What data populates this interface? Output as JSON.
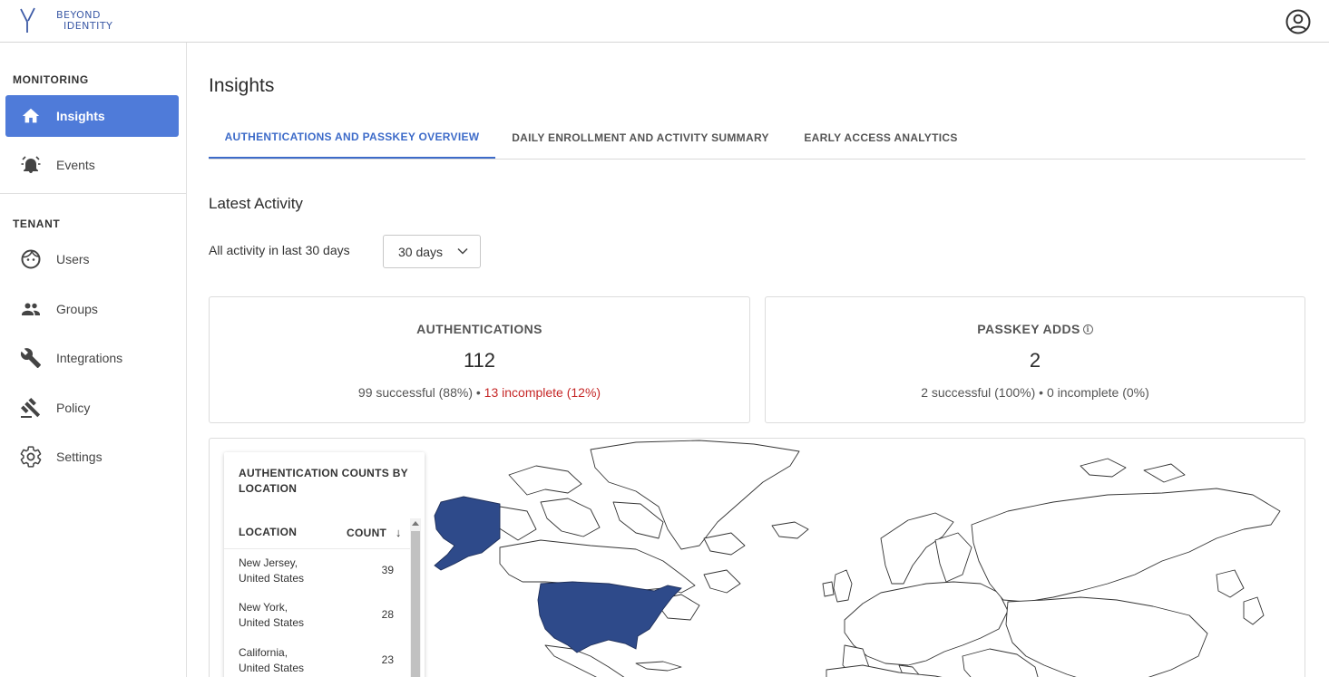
{
  "brand": {
    "line1": "BEYOND",
    "line2": "IDENTITY"
  },
  "sidebar": {
    "monitoring_label": "MONITORING",
    "tenant_label": "TENANT",
    "items": [
      {
        "label": "Insights",
        "icon": "home-icon"
      },
      {
        "label": "Events",
        "icon": "alarm-icon"
      },
      {
        "label": "Users",
        "icon": "face-icon"
      },
      {
        "label": "Groups",
        "icon": "people-icon"
      },
      {
        "label": "Integrations",
        "icon": "wrench-icon"
      },
      {
        "label": "Policy",
        "icon": "gavel-icon"
      },
      {
        "label": "Settings",
        "icon": "gear-icon"
      }
    ]
  },
  "page": {
    "title": "Insights"
  },
  "tabs": [
    "AUTHENTICATIONS AND PASSKEY OVERVIEW",
    "DAILY ENROLLMENT AND ACTIVITY SUMMARY",
    "EARLY ACCESS ANALYTICS"
  ],
  "activity": {
    "section_title": "Latest Activity",
    "filter_label": "All activity in last 30 days",
    "range_value": "30 days"
  },
  "cards": {
    "authentications": {
      "title": "AUTHENTICATIONS",
      "total": "112",
      "successful": "99 successful (88%)",
      "separator": "•",
      "incomplete": "13 incomplete (12%)"
    },
    "passkey_adds": {
      "title": "PASSKEY ADDS",
      "info": "i",
      "total": "2",
      "successful": "2 successful (100%)",
      "separator": "•",
      "incomplete": "0 incomplete (0%)"
    }
  },
  "location_panel": {
    "title": "AUTHENTICATION COUNTS BY LOCATION",
    "col_location": "LOCATION",
    "col_count": "COUNT",
    "sort_arrow": "↓",
    "rows": [
      {
        "line1": "New Jersey,",
        "line2": "United States",
        "count": "39"
      },
      {
        "line1": "New York,",
        "line2": "United States",
        "count": "28"
      },
      {
        "line1": "California,",
        "line2": "United States",
        "count": "23"
      }
    ]
  },
  "colors": {
    "accent": "#4f7bd9",
    "tab_active": "#3d6bc9",
    "map_highlight": "#2e4a8a",
    "error": "#c62828",
    "brand": "#3c5aa6"
  }
}
